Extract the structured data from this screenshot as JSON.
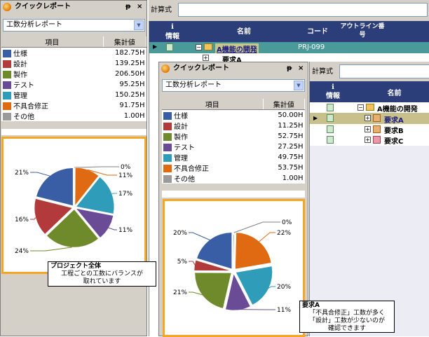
{
  "colors": {
    "spec": "#3a5ea5",
    "design": "#b23a3a",
    "build": "#6f8a2a",
    "test": "#6a4b96",
    "mgmt": "#2f9dba",
    "defect": "#e06a12",
    "other": "#9a9a9a",
    "callout_border": "#f5a623",
    "grid_header": "#2c3e7a"
  },
  "back_panel": {
    "title": "クイックレポート",
    "report_select": "工数分析レポート",
    "col_item": "項目",
    "col_total": "集計値",
    "rows": [
      {
        "label": "仕様",
        "value": "182.75H",
        "color_key": "spec"
      },
      {
        "label": "設計",
        "value": "139.25H",
        "color_key": "design"
      },
      {
        "label": "製作",
        "value": "206.50H",
        "color_key": "build"
      },
      {
        "label": "テスト",
        "value": "95.25H",
        "color_key": "test"
      },
      {
        "label": "管理",
        "value": "150.25H",
        "color_key": "mgmt"
      },
      {
        "label": "不具合修正",
        "value": "91.75H",
        "color_key": "defect"
      },
      {
        "label": "その他",
        "value": "1.00H",
        "color_key": "other"
      }
    ],
    "pie_labels": [
      "0%",
      "11%",
      "17%",
      "11%",
      "24%",
      "16%",
      "21%"
    ],
    "callout_title": "プロジェクト全体",
    "callout_body": [
      "工程ごとの工数にバランスが",
      "取れています"
    ]
  },
  "back_grid": {
    "formula_label": "計算式",
    "headers": [
      "情報",
      "名前",
      "コード",
      "アウトライン番号"
    ],
    "row1_name": "A機能の開発",
    "row1_code": "PRJ-099",
    "row2_name": "要求A"
  },
  "front_panel": {
    "title": "クイックレポート",
    "report_select": "工数分析レポート",
    "col_item": "項目",
    "col_total": "集計値",
    "rows": [
      {
        "label": "仕様",
        "value": "50.00H",
        "color_key": "spec"
      },
      {
        "label": "設計",
        "value": "11.25H",
        "color_key": "design"
      },
      {
        "label": "製作",
        "value": "52.75H",
        "color_key": "build"
      },
      {
        "label": "テスト",
        "value": "27.25H",
        "color_key": "test"
      },
      {
        "label": "管理",
        "value": "49.75H",
        "color_key": "mgmt"
      },
      {
        "label": "不具合修正",
        "value": "53.75H",
        "color_key": "defect"
      },
      {
        "label": "その他",
        "value": "1.00H",
        "color_key": "other"
      }
    ],
    "pie_labels": [
      "0%",
      "22%",
      "20%",
      "11%",
      "21%",
      "5%",
      "20%"
    ],
    "callout_title": "要求A",
    "callout_body": [
      "「不具合修正」工数が多く",
      "「設計」工数が少ないのが",
      "確認できます"
    ]
  },
  "front_grid": {
    "formula_label": "計算式",
    "headers": [
      "情報",
      "名前"
    ],
    "rows": [
      "A機能の開発",
      "要求A",
      "要求B",
      "要求C"
    ]
  }
}
